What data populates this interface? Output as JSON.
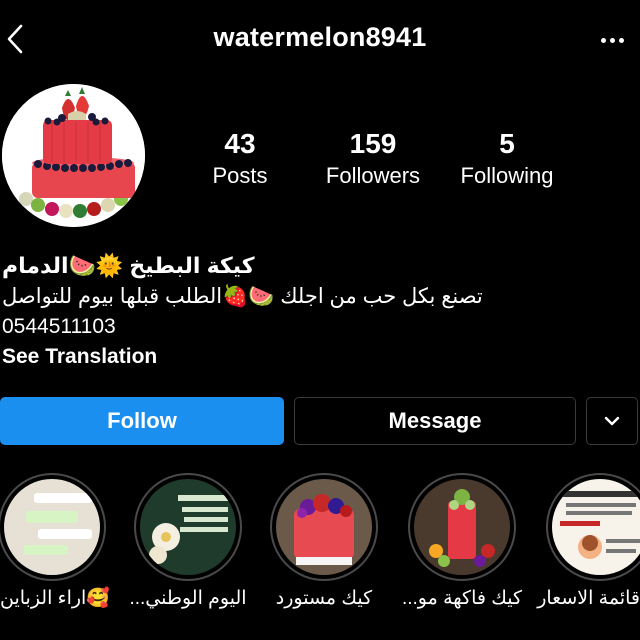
{
  "header": {
    "username": "watermelon8941",
    "back_icon": "chevron-left-icon",
    "more_icon": "more-horizontal-icon"
  },
  "stats": {
    "posts": {
      "count": "43",
      "label": "Posts"
    },
    "followers": {
      "count": "159",
      "label": "Followers"
    },
    "following": {
      "count": "5",
      "label": "Following"
    }
  },
  "bio": {
    "name": "كيكة البطيخ 🌞🍉الدمام",
    "line1": "تصنع بكل حب من اجلك 🍉🍓الطلب قبلها بيوم للتواصل",
    "phone": "0544511103",
    "see_translation": "See Translation"
  },
  "actions": {
    "follow_label": "Follow",
    "message_label": "Message",
    "dropdown_icon": "chevron-down-icon"
  },
  "highlights": [
    {
      "label": "🥰اراء الزباين"
    },
    {
      "label": "اليوم الوطني..."
    },
    {
      "label": "كيك مستورد"
    },
    {
      "label": "كيك فاكهة مو..."
    },
    {
      "label": "قائمة الاسعار"
    }
  ],
  "colors": {
    "background": "#000000",
    "follow_button": "#1a8ff0",
    "border": "#3a3a3a"
  }
}
